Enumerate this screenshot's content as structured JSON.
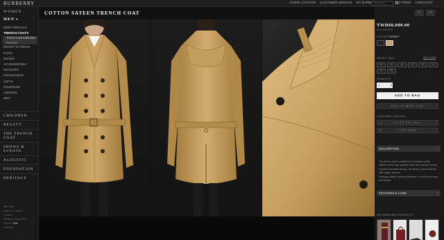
{
  "topbar": {
    "logo": "BURBERRY",
    "links": [
      "STORE LOCATOR",
      "CUSTOMER SERVICE",
      "MY BURBERRY"
    ],
    "search_placeholder": "SEARCH",
    "bag_label": "0 ITEMS",
    "checkout_label": "CHECKOUT"
  },
  "leftnav": {
    "women": "WOMEN",
    "men": "MEN",
    "men_marker": "▾",
    "items_before": [
      "NEW ARRIVALS",
      "TRENCH COATS"
    ],
    "trench_sub": [
      "Trench Coat Collection",
      "Bespoke"
    ],
    "items_after": [
      "READY-TO-WEAR",
      "BAGS",
      "SHOES",
      "ACCESSORIES",
      "WATCHES",
      "FRAGRANCE",
      "GIFTS",
      "PRORSUM",
      "LONDON",
      "BRIT"
    ],
    "sections": [
      "CHILDREN",
      "BEAUTY",
      "THE TRENCH COAT",
      "SHOWS & EVENTS",
      "ACOUSTIC",
      "FOUNDATION",
      "HERITAGE"
    ],
    "footer": [
      "Site Map",
      "Legal & Cookies",
      "Careers",
      "Burberry Group Plc",
      "Taiwan"
    ],
    "footer_edit": "Edit",
    "footer_lang": "Chinese"
  },
  "product": {
    "title": "COTTON SATEEN TRENCH COAT",
    "price": "TWD60,000.00",
    "item_no": "Item 39494301",
    "colour_label": "COLOUR",
    "colour_value": "HONEY",
    "size_label": "SELECT SIZE",
    "size_guide": "Size Guide",
    "sizes": [
      "44",
      "46",
      "48",
      "50",
      "52",
      "54",
      "56",
      "58"
    ],
    "quantity_label": "QUANTITY",
    "quantity_value": "1",
    "add_to_bag": "ADD TO BAG",
    "wish_list": "ADD TO WISH LIST",
    "customer_service_label": "CUSTOMER SERVICE",
    "click_to_call": "CLICK TO CALL",
    "live_chat": "LIVE CHAT",
    "description_label": "DESCRIPTION",
    "description": [
      "The trench coat is crafted from compact cotton sateen, which has a subtle lustre and smooth texture.",
      "A double-breasted design, the trench coat is tailored with raglan sleeves.",
      "Heritage details include epaulettes, a belt closure and cuff straps."
    ],
    "features_label": "FEATURES & CARE",
    "recommended_label": "RECOMMENDED PRODUCTS"
  },
  "nav": {
    "prev": "‹",
    "next": "›",
    "collapse": "−",
    "expand": "+"
  },
  "colors": {
    "coat": "#c9a163",
    "bg": "#111111",
    "panel": "#1a1a1a"
  }
}
